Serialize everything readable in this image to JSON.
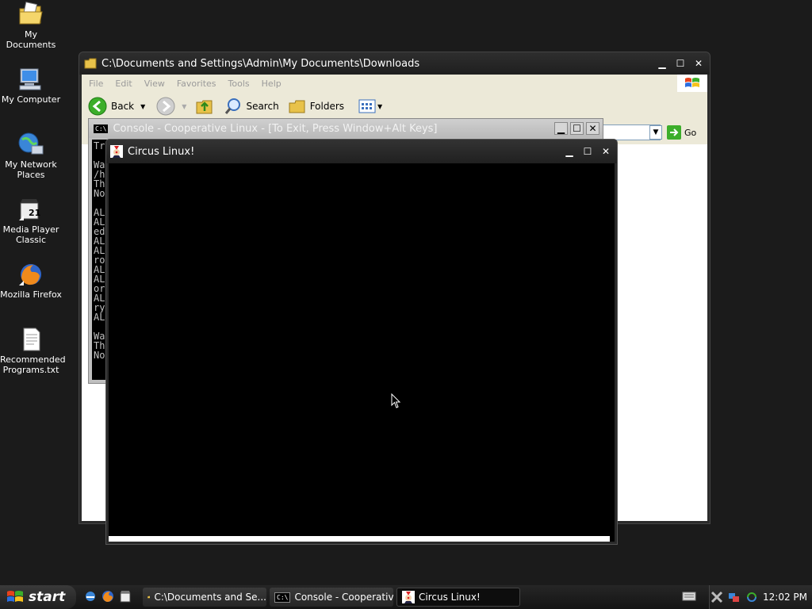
{
  "desktop": {
    "icons": [
      {
        "label": "My Documents",
        "icon": "folder-documents-icon"
      },
      {
        "label": "My Computer",
        "icon": "computer-icon"
      },
      {
        "label": "My Network Places",
        "icon": "network-icon"
      },
      {
        "label": "Media Player Classic",
        "icon": "media-player-icon"
      },
      {
        "label": "Mozilla Firefox",
        "icon": "firefox-icon"
      },
      {
        "label": "Recommended Programs.txt",
        "icon": "text-file-icon"
      }
    ],
    "background_color": "#1b1b1b"
  },
  "explorer": {
    "title": "C:\\Documents and Settings\\Admin\\My Documents\\Downloads",
    "menu": [
      "File",
      "Edit",
      "View",
      "Favorites",
      "Tools",
      "Help"
    ],
    "toolbar": {
      "back": "Back",
      "search": "Search",
      "folders": "Folders"
    },
    "go_label": "Go"
  },
  "console": {
    "title": "Console - Cooperative Linux - [To Exit, Press Window+Alt Keys]",
    "lines": [
      "Tr",
      "",
      "Wa",
      "/h",
      "Th",
      "No",
      "",
      "AL",
      "AL",
      "ed",
      "AL",
      "AL",
      "ro",
      "AL",
      "AL",
      "or",
      "AL",
      "ry",
      "AL",
      "",
      "Wa",
      "Th",
      "No"
    ]
  },
  "circus": {
    "title": "Circus Linux!"
  },
  "taskbar": {
    "start_label": "start",
    "tasks": [
      {
        "label": "C:\\Documents and Se...",
        "active": false
      },
      {
        "label": "Console - Cooperativ...",
        "active": false
      },
      {
        "label": "Circus Linux!",
        "active": true
      }
    ],
    "clock": "12:02 PM"
  }
}
